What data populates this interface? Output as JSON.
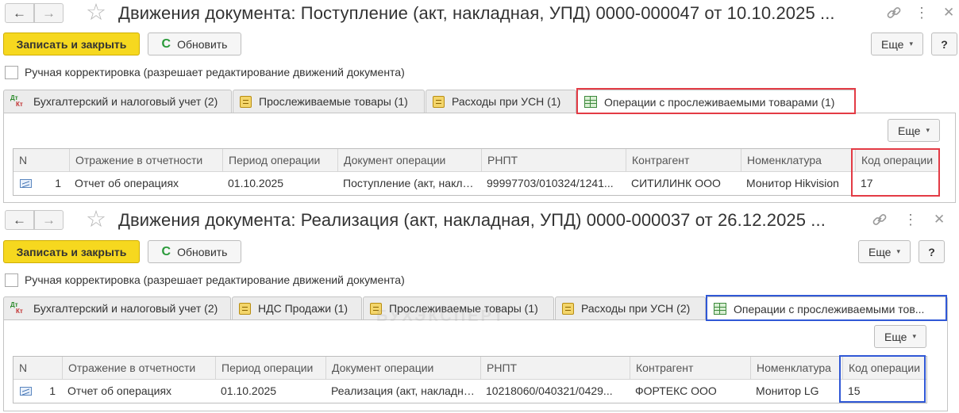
{
  "watermark": "БУХЭКСПЕРТ",
  "colors": {
    "primary_button": "#f6d81f",
    "highlight_red": "#e33b45",
    "highlight_blue": "#3058d6"
  },
  "common": {
    "back_icon": "←",
    "forward_icon": "→",
    "star_icon": "☆",
    "menu_icon": "⋮",
    "close_icon": "✕",
    "refresh_icon": "C",
    "caret": "▾",
    "help_label": "?"
  },
  "windows": [
    {
      "title": "Движения документа: Поступление (акт, накладная, УПД) 0000-000047 от 10.10.2025 ...",
      "save_close_label": "Записать и закрыть",
      "refresh_label": "Обновить",
      "more_label": "Еще",
      "manual_label": "Ручная корректировка (разрешает редактирование движений документа)",
      "tabs": [
        {
          "label": "Бухгалтерский и налоговый учет (2)",
          "icon": "dt-kt-icon"
        },
        {
          "label": "Прослеживаемые товары (1)",
          "icon": "register-icon"
        },
        {
          "label": "Расходы при УСН (1)",
          "icon": "register-icon"
        },
        {
          "label": "Операции с прослеживаемыми товарами (1)",
          "icon": "table-icon",
          "active": true
        }
      ],
      "panel_more_label": "Еще",
      "table": {
        "columns": [
          "N",
          "Отражение в отчетности",
          "Период операции",
          "Документ операции",
          "РНПТ",
          "Контрагент",
          "Номенклатура",
          "Код операции"
        ],
        "rows": [
          {
            "n": "1",
            "reflection": "Отчет об операциях",
            "period": "01.10.2025",
            "document": "Поступление (акт, накладная, УПД)",
            "rnpt": "99997703/010324/1241...",
            "counterparty": "СИТИЛИНК ООО",
            "nomenclature": "Монитор Hikvision",
            "code": "17"
          }
        ]
      }
    },
    {
      "title": "Движения документа: Реализация (акт, накладная, УПД) 0000-000037 от 26.12.2025 ...",
      "save_close_label": "Записать и закрыть",
      "refresh_label": "Обновить",
      "more_label": "Еще",
      "manual_label": "Ручная корректировка (разрешает редактирование движений документа)",
      "tabs": [
        {
          "label": "Бухгалтерский и налоговый учет (2)",
          "icon": "dt-kt-icon"
        },
        {
          "label": "НДС Продажи (1)",
          "icon": "register-icon"
        },
        {
          "label": "Прослеживаемые товары (1)",
          "icon": "register-icon"
        },
        {
          "label": "Расходы при УСН (2)",
          "icon": "register-icon"
        },
        {
          "label": "Операции с прослеживаемыми тов...",
          "icon": "table-icon",
          "active": true
        }
      ],
      "panel_more_label": "Еще",
      "table": {
        "columns": [
          "N",
          "Отражение в отчетности",
          "Период операции",
          "Документ операции",
          "РНПТ",
          "Контрагент",
          "Номенклатура",
          "Код операции"
        ],
        "rows": [
          {
            "n": "1",
            "reflection": "Отчет об операциях",
            "period": "01.10.2025",
            "document": "Реализация (акт, накладная, УПД)",
            "rnpt": "10218060/040321/0429...",
            "counterparty": "ФОРТЕКС ООО",
            "nomenclature": "Монитор LG",
            "code": "15"
          }
        ]
      }
    }
  ]
}
